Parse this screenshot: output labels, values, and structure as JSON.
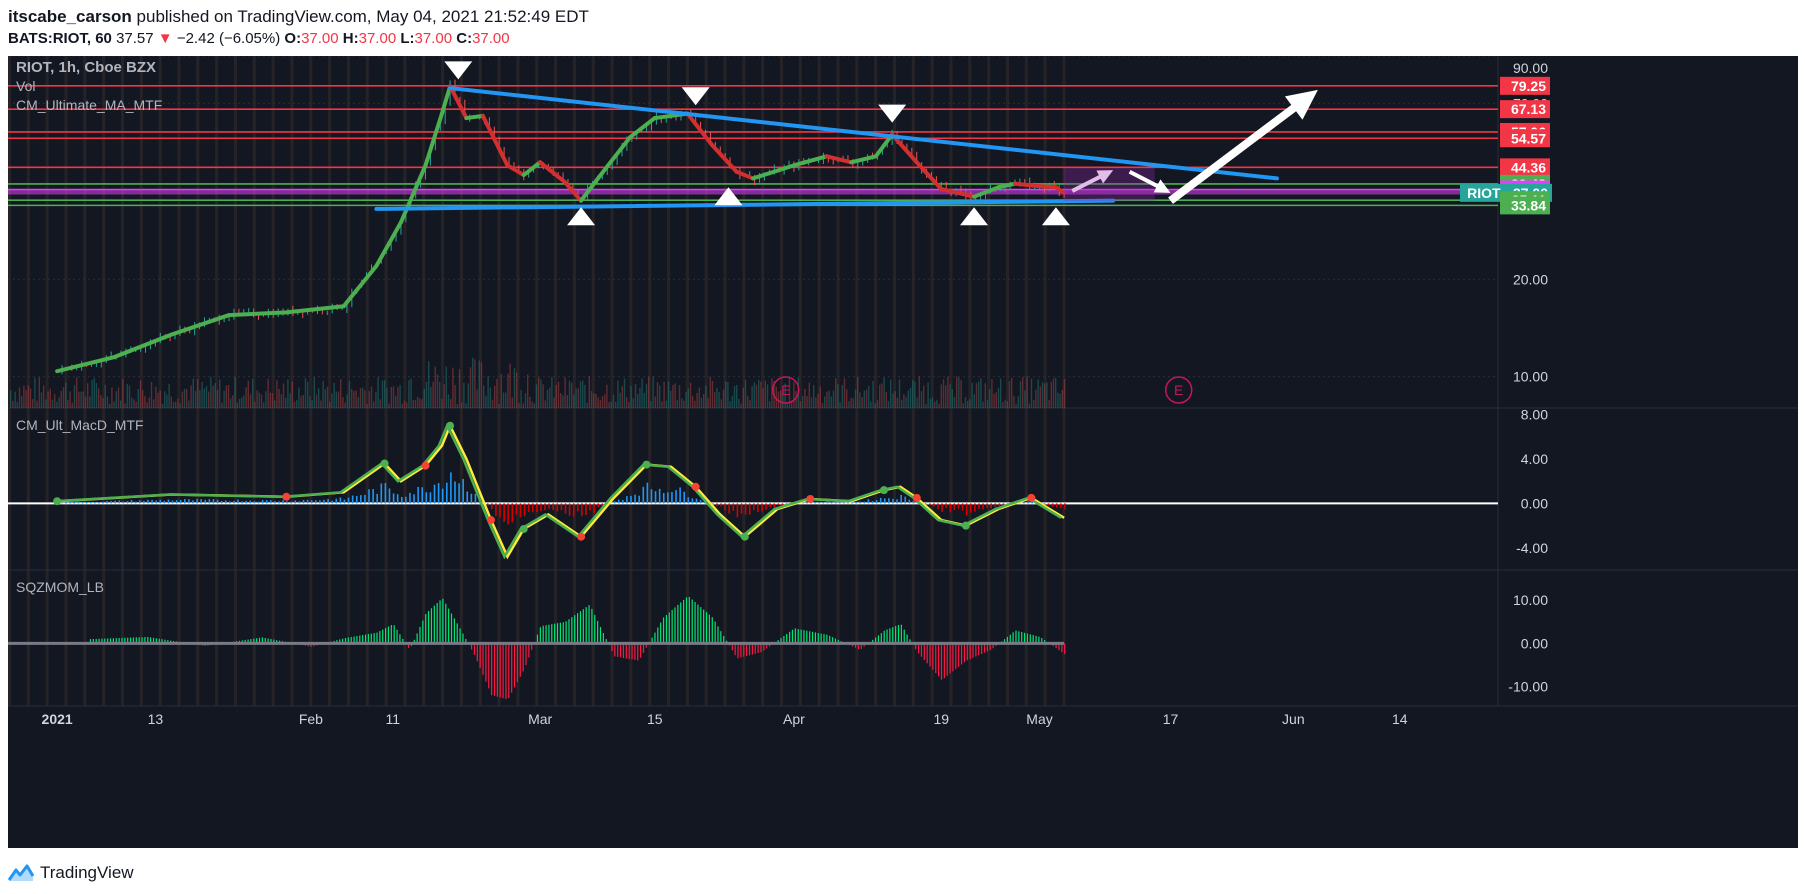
{
  "header": {
    "author": "itscabe_carson",
    "published_text": "published on TradingView.com, May 04, 2021 21:52:49 EDT",
    "symbol_line": "BATS:RIOT, 60",
    "last": "37.57",
    "change_arrow": "▼",
    "change": "−2.42 (−6.05%)",
    "o_label": "O:",
    "o": "37.00",
    "h_label": "H:",
    "h": "37.00",
    "l_label": "L:",
    "l": "37.00",
    "c_label": "C:",
    "c": "37.00"
  },
  "footer": {
    "brand": "TradingView",
    "logo_icon": "tradingview-logo-icon"
  },
  "colors": {
    "background": "#131722",
    "bull": "#26a69a",
    "bear": "#ef5350",
    "resistance": "#f23645",
    "support": "#4caf50",
    "trendline": "#2196f3",
    "ma_up": "#4caf50",
    "ma_down": "#d32f2f"
  },
  "chart_data": [
    {
      "type": "candlestick",
      "panel": "main",
      "labels": [
        "RIOT, 1h, Cboe BZX",
        "Vol",
        "CM_Ultimate_MA_MTF"
      ],
      "x_ticks": [
        "2021",
        "13",
        "Feb",
        "11",
        "Mar",
        "15",
        "Apr",
        "19",
        "May",
        "17",
        "Jun",
        "14"
      ],
      "y_scale": "log",
      "y_ticks": [
        "90.00",
        "70.00",
        "20.00",
        "10.00"
      ],
      "ylim": [
        8,
        98
      ],
      "close_path": [
        [
          "2021-01-01",
          10.4
        ],
        [
          "2021-01-08",
          11.5
        ],
        [
          "2021-01-15",
          13.5
        ],
        [
          "2021-01-22",
          15.5
        ],
        [
          "2021-01-29",
          15.8
        ],
        [
          "2021-02-05",
          16.5
        ],
        [
          "2021-02-09",
          22
        ],
        [
          "2021-02-12",
          30
        ],
        [
          "2021-02-15",
          45
        ],
        [
          "2021-02-17",
          65
        ],
        [
          "2021-02-18",
          79
        ],
        [
          "2021-02-20",
          63
        ],
        [
          "2021-02-22",
          64
        ],
        [
          "2021-02-25",
          45
        ],
        [
          "2021-02-27",
          42
        ],
        [
          "2021-03-01",
          46
        ],
        [
          "2021-03-04",
          40
        ],
        [
          "2021-03-06",
          35
        ],
        [
          "2021-03-09",
          44
        ],
        [
          "2021-03-12",
          55
        ],
        [
          "2021-03-15",
          63
        ],
        [
          "2021-03-19",
          65
        ],
        [
          "2021-03-22",
          52
        ],
        [
          "2021-03-25",
          43
        ],
        [
          "2021-03-27",
          41
        ],
        [
          "2021-04-01",
          45
        ],
        [
          "2021-04-05",
          48
        ],
        [
          "2021-04-08",
          46
        ],
        [
          "2021-04-11",
          48
        ],
        [
          "2021-04-13",
          56
        ],
        [
          "2021-04-16",
          46
        ],
        [
          "2021-04-19",
          38
        ],
        [
          "2021-04-21",
          37
        ],
        [
          "2021-04-23",
          36
        ],
        [
          "2021-04-26",
          38.5
        ],
        [
          "2021-04-28",
          39.5
        ],
        [
          "2021-04-30",
          39
        ],
        [
          "2021-05-03",
          38.5
        ],
        [
          "2021-05-04",
          37
        ]
      ],
      "resistance_levels": [
        79.25,
        67.13,
        57.06,
        54.57,
        44.36,
        37.89
      ],
      "support_levels": [
        39.43,
        35.11,
        33.84
      ],
      "price_tags": [
        {
          "text": "79.25",
          "value": 79.25,
          "color": "#f23645"
        },
        {
          "text": "67.13",
          "value": 67.13,
          "color": "#f23645"
        },
        {
          "text": "57.06",
          "value": 57.06,
          "color": "#f23645"
        },
        {
          "text": "54.57",
          "value": 54.57,
          "color": "#f23645"
        },
        {
          "text": "44.36",
          "value": 44.36,
          "color": "#f23645"
        },
        {
          "text": "39.43",
          "value": 39.43,
          "color": "#4caf50"
        },
        {
          "text": "37.89",
          "value": 37.89,
          "color": "#e040fb"
        },
        {
          "text": "RIOT · 37.00",
          "value": 37.0,
          "color": "#26a69a"
        },
        {
          "text": "35.11",
          "value": 35.11,
          "color": "#4caf50"
        },
        {
          "text": "33.84",
          "value": 33.84,
          "color": "#4caf50"
        }
      ],
      "earnings_markers": [
        {
          "date": "2021-03-31",
          "text": "E"
        },
        {
          "date": "2021-05-18",
          "text": "E"
        }
      ],
      "annotations": {
        "trendline_down": {
          "from": [
            "2021-02-18",
            78
          ],
          "to": [
            "2021-05-30",
            41
          ]
        },
        "trendline_up": {
          "from": [
            "2021-02-09",
            33
          ],
          "to": [
            "2021-05-10",
            35
          ]
        },
        "box": {
          "from": [
            "2021-05-04",
            44
          ],
          "to": [
            "2021-05-15",
            35
          ]
        },
        "projection_arrow_up": {
          "from": [
            "2021-05-17",
            35
          ],
          "to": [
            "2021-06-04",
            77
          ]
        }
      }
    },
    {
      "type": "line",
      "panel": "macd",
      "label": "CM_Ult_MacD_MTF",
      "y_ticks": [
        "8.00",
        "4.00",
        "0.00",
        "-4.00"
      ],
      "ylim": [
        -6,
        8.6
      ],
      "x": [
        "2021-01-01",
        "2021-01-15",
        "2021-01-29",
        "2021-02-05",
        "2021-02-10",
        "2021-02-12",
        "2021-02-15",
        "2021-02-17",
        "2021-02-18",
        "2021-02-20",
        "2021-02-23",
        "2021-02-25",
        "2021-02-27",
        "2021-03-02",
        "2021-03-06",
        "2021-03-10",
        "2021-03-14",
        "2021-03-17",
        "2021-03-20",
        "2021-03-23",
        "2021-03-26",
        "2021-03-30",
        "2021-04-03",
        "2021-04-08",
        "2021-04-12",
        "2021-04-14",
        "2021-04-16",
        "2021-04-19",
        "2021-04-22",
        "2021-04-26",
        "2021-04-30",
        "2021-05-04"
      ],
      "values": [
        0.2,
        0.8,
        0.6,
        1.0,
        3.6,
        2.0,
        3.4,
        5.2,
        7.0,
        4.0,
        -1.5,
        -4.8,
        -2.3,
        -1.0,
        -3.0,
        0.5,
        3.5,
        3.3,
        1.5,
        -1.0,
        -3.0,
        -0.5,
        0.4,
        0.2,
        1.2,
        1.5,
        0.5,
        -1.5,
        -2.0,
        -0.5,
        0.5,
        -1.3
      ]
    },
    {
      "type": "bar",
      "panel": "squeeze",
      "label": "SQZMOM_LB",
      "y_ticks": [
        "10.00",
        "0.00",
        "-10.00"
      ],
      "ylim": [
        -14.5,
        17
      ],
      "x": [
        "2021-01-05",
        "2021-01-12",
        "2021-01-19",
        "2021-01-26",
        "2021-02-01",
        "2021-02-05",
        "2021-02-09",
        "2021-02-11",
        "2021-02-13",
        "2021-02-15",
        "2021-02-17",
        "2021-02-19",
        "2021-02-21",
        "2021-02-23",
        "2021-02-25",
        "2021-02-27",
        "2021-03-01",
        "2021-03-04",
        "2021-03-07",
        "2021-03-10",
        "2021-03-13",
        "2021-03-16",
        "2021-03-19",
        "2021-03-22",
        "2021-03-25",
        "2021-03-28",
        "2021-04-01",
        "2021-04-05",
        "2021-04-09",
        "2021-04-12",
        "2021-04-14",
        "2021-04-16",
        "2021-04-19",
        "2021-04-22",
        "2021-04-25",
        "2021-04-28",
        "2021-05-01",
        "2021-05-04"
      ],
      "values": [
        1.0,
        1.5,
        -0.6,
        1.4,
        -0.8,
        1.2,
        2.5,
        4.5,
        -1.5,
        7.0,
        10.5,
        4.0,
        -3.0,
        -12.0,
        -13.0,
        -6.0,
        4.0,
        5.0,
        9.0,
        -3.0,
        -4.0,
        6.0,
        11.0,
        6.0,
        -3.5,
        -2.0,
        3.5,
        2.0,
        -1.5,
        3.0,
        4.5,
        -2.0,
        -8.5,
        -4.0,
        -1.5,
        3.0,
        1.5,
        -2.5
      ]
    }
  ]
}
